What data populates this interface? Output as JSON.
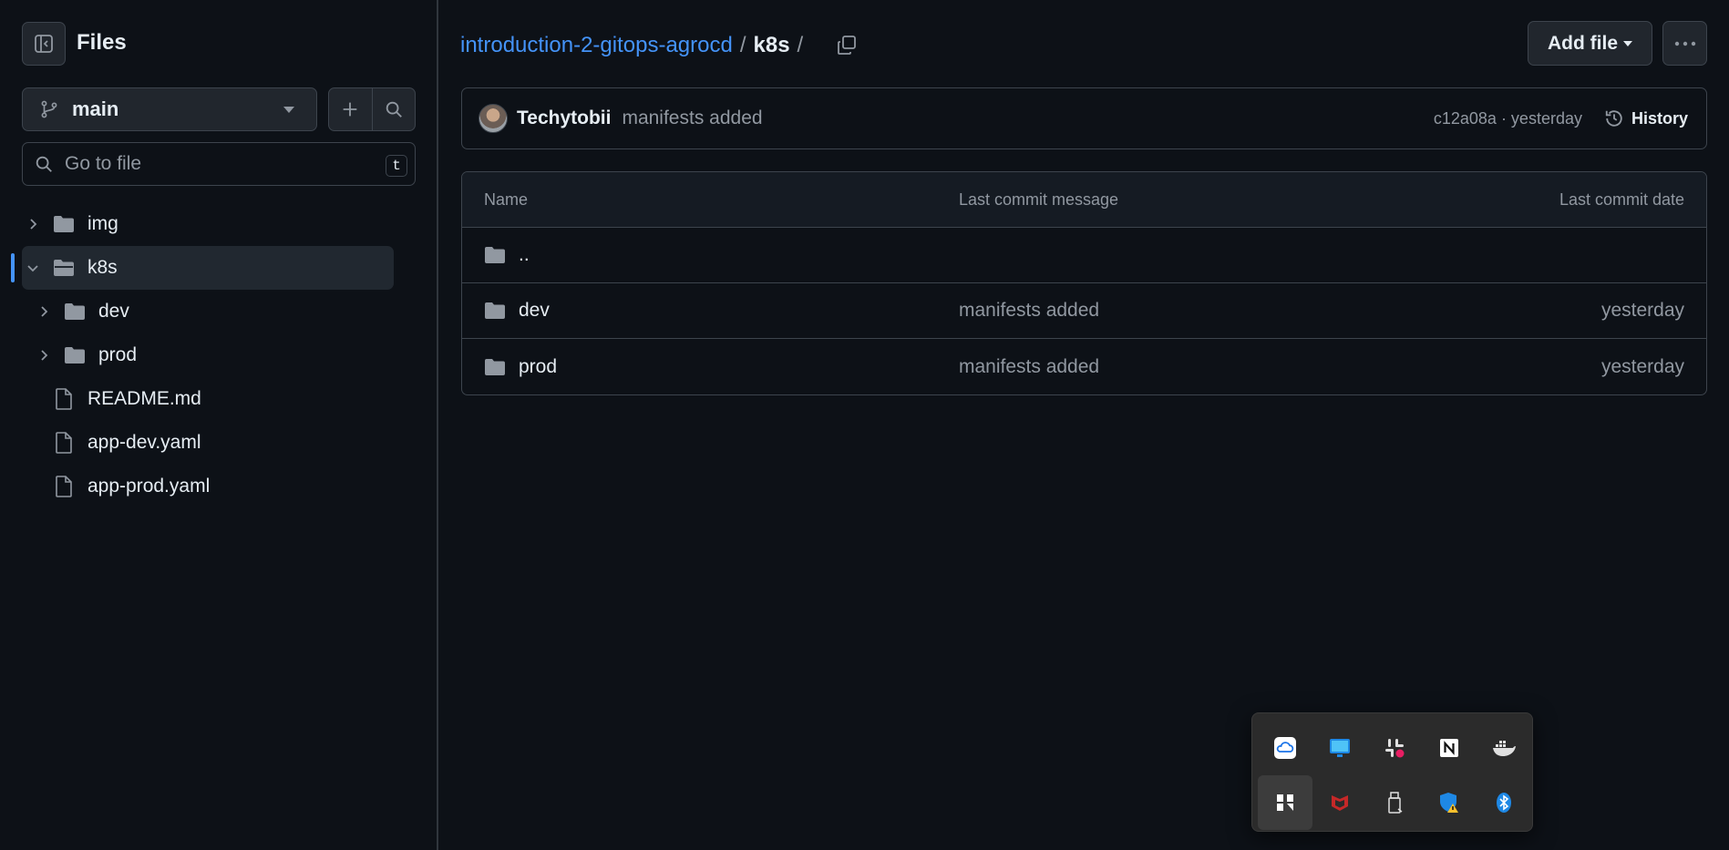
{
  "sidebar": {
    "title": "Files",
    "branch": "main",
    "search_placeholder": "Go to file",
    "search_shortcut": "t",
    "tree": [
      {
        "label": "img",
        "type": "folder",
        "expanded": false,
        "depth": 0
      },
      {
        "label": "k8s",
        "type": "folder",
        "expanded": true,
        "depth": 0,
        "selected": true
      },
      {
        "label": "dev",
        "type": "folder",
        "expanded": false,
        "depth": 1
      },
      {
        "label": "prod",
        "type": "folder",
        "expanded": false,
        "depth": 1
      },
      {
        "label": "README.md",
        "type": "file",
        "depth": 0
      },
      {
        "label": "app-dev.yaml",
        "type": "file",
        "depth": 0
      },
      {
        "label": "app-prod.yaml",
        "type": "file",
        "depth": 0
      }
    ]
  },
  "header": {
    "repo": "introduction-2-gitops-agrocd",
    "separator": "/",
    "current": "k8s",
    "trailing": "/",
    "add_file_label": "Add file"
  },
  "commit": {
    "author": "Techytobii",
    "message": "manifests added",
    "meta": "c12a08a · yesterday",
    "history_label": "History"
  },
  "table": {
    "columns": {
      "name": "Name",
      "message": "Last commit message",
      "date": "Last commit date"
    },
    "parent": "..",
    "rows": [
      {
        "name": "dev",
        "message": "manifests added",
        "date": "yesterday"
      },
      {
        "name": "prod",
        "message": "manifests added",
        "date": "yesterday"
      }
    ]
  },
  "tray": {
    "icons": [
      "cloud-icon",
      "monitor-app-icon",
      "slack-icon",
      "notion-icon",
      "docker-icon",
      "windows-app-icon",
      "mcafee-icon",
      "usb-drive-icon",
      "security-warning-icon",
      "bluetooth-icon"
    ]
  },
  "colors": {
    "accent": "#4493f8",
    "background": "#0d1117",
    "border": "#3d444d",
    "muted": "#9198a1"
  }
}
